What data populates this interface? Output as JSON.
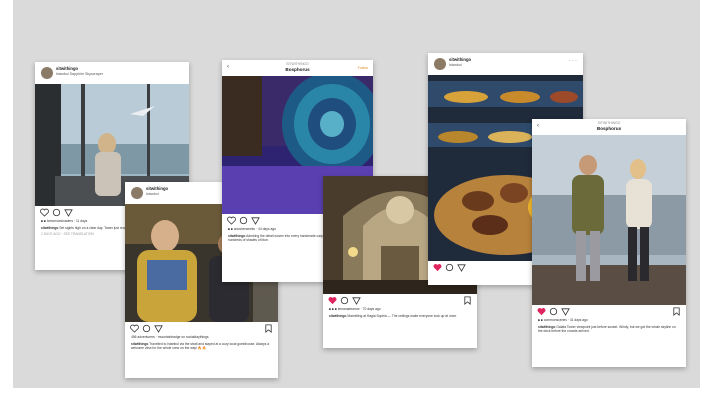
{
  "posts": [
    {
      "username": "sitwithingo",
      "location": "Istanbul Sapphire Skyscraper",
      "likes": "■ ■ tomorrowsloaders  ·  11 days",
      "caption_user": "sitwithingo",
      "caption": "Set sights high on a clear day. Tower just reopened after renovation.",
      "timestamp": "2 DAYS AGO   ·   SEE TRANSLATION"
    },
    {
      "username": "sitwithingo",
      "location": "Istanbul",
      "likes": "456 adventurers  ·  mountainbadge on socialdaythings",
      "caption_user": "sitwithingo",
      "caption": "Travelled to Istanbul via the strait and stayed at a cozy local guesthouse. Always a welcome view for the whole crew on the way! 🔥🔥"
    },
    {
      "top_label": "SITWITHINGO",
      "title": "Bosphorus",
      "follow": "Follow",
      "likes": "■ ■ anosherweeks  ·  44 days ago",
      "caption_user": "sitwithingo",
      "caption": "Admiring the detail woven into every handmade carpet at the market. This one had hundreds of shades of blue."
    },
    {
      "likes": "■ ■ ■ lemanadeamor  ·  70 days ago",
      "caption_user": "sitwithingo",
      "caption": "Marvelling at Hagia Sophia — The ceilings make everyone look up at once."
    },
    {
      "username": "sitwithingo",
      "location": "Istanbul",
      "top_label": "SITWITHINGO"
    },
    {
      "top_label": "SITWITHINGO",
      "title": "Bosphorus",
      "likes": "■ ■ commonscenes  ·  41 days ago",
      "caption_user": "sitwithingo",
      "caption": "Galata Tower viewpoint just before sunset. Windy, but we got the whole skyline on the deck before the crowds arrived."
    }
  ],
  "colors": {
    "background": "#dadada",
    "card": "#ffffff",
    "like": "#e0245e",
    "follow": "#e08a2a"
  },
  "icons": [
    "heart-icon",
    "comment-icon",
    "share-icon",
    "bookmark-icon",
    "more-icon",
    "back-arrow-icon"
  ]
}
